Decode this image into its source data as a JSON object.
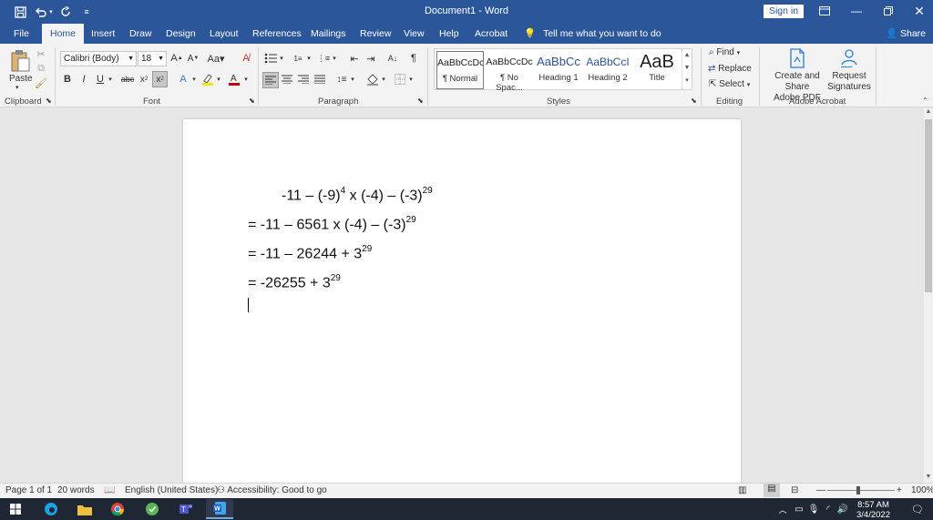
{
  "titlebar": {
    "title": "Document1  -  Word",
    "sign_in": "Sign in",
    "save_icon": "save-icon",
    "undo_icon": "undo-icon",
    "redo_icon": "redo-icon"
  },
  "tabs": [
    "File",
    "Home",
    "Insert",
    "Draw",
    "Design",
    "Layout",
    "References",
    "Mailings",
    "Review",
    "View",
    "Help",
    "Acrobat"
  ],
  "active_tab": "Home",
  "tell_me": "Tell me what you want to do",
  "share": "Share",
  "ribbon": {
    "clipboard": {
      "paste": "Paste",
      "label": "Clipboard"
    },
    "font": {
      "name": "Calibri (Body)",
      "size": "18",
      "label": "Font"
    },
    "paragraph": {
      "label": "Paragraph"
    },
    "styles": {
      "label": "Styles",
      "items": [
        {
          "preview": "AaBbCcDc",
          "name": "¶ Normal"
        },
        {
          "preview": "AaBbCcDc",
          "name": "¶ No Spac..."
        },
        {
          "preview": "AaBbCc",
          "name": "Heading 1"
        },
        {
          "preview": "AaBbCcI",
          "name": "Heading 2"
        },
        {
          "preview": "AaB",
          "name": "Title"
        }
      ]
    },
    "editing": {
      "find": "Find",
      "replace": "Replace",
      "select": "Select",
      "label": "Editing"
    },
    "acrobat": {
      "create_line1": "Create and Share",
      "create_line2": "Adobe PDF",
      "request_line1": "Request",
      "request_line2": "Signatures",
      "label": "Adobe Acrobat"
    }
  },
  "document": {
    "lines": [
      {
        "prefix": "",
        "parts": [
          "-11 – (-9)",
          "4",
          " x (-4) – (-3)",
          "29"
        ]
      },
      {
        "prefix": "= ",
        "parts": [
          "-11 – 6561 x (-4) – (-3)",
          "29",
          "",
          ""
        ]
      },
      {
        "prefix": "= ",
        "parts": [
          "-11 – 26244 + 3",
          "29",
          "",
          ""
        ]
      },
      {
        "prefix": "= ",
        "parts": [
          "-26255 + 3",
          "29",
          "",
          ""
        ]
      }
    ]
  },
  "status": {
    "page": "Page 1 of 1",
    "words": "20 words",
    "language": "English (United States)",
    "accessibility": "Accessibility: Good to go",
    "zoom": "100%"
  },
  "taskbar": {
    "time": "8:57 AM",
    "date": "3/4/2022"
  },
  "colors": {
    "word_blue": "#2b579a",
    "ribbon_bg": "#f3f3f3",
    "canvas_bg": "#e6e6e6",
    "taskbar_bg": "#202734"
  }
}
